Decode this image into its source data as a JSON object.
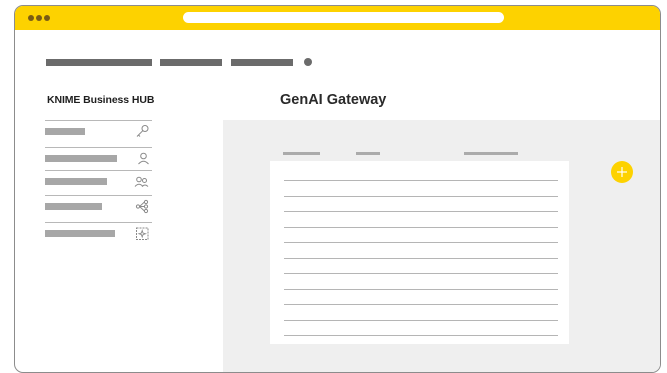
{
  "app": {
    "brand": "KNIME Business HUB",
    "page_title": "GenAI Gateway"
  },
  "colors": {
    "accent": "#fdd200",
    "panel": "#efefef",
    "placeholder": "#a7a7a7"
  },
  "sidebar": {
    "items": [
      {
        "icon": "key-icon"
      },
      {
        "icon": "user-icon"
      },
      {
        "icon": "users-icon"
      },
      {
        "icon": "workflow-icon"
      },
      {
        "icon": "ai-sparkle-icon"
      }
    ]
  },
  "main": {
    "add_icon": "plus-icon",
    "row_count": 11
  }
}
